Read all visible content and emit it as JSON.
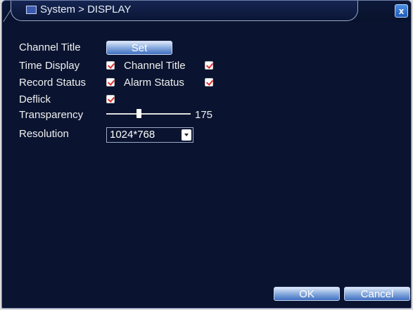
{
  "window": {
    "title": "System > DISPLAY",
    "close_symbol": "x"
  },
  "settings": {
    "channel_title_label": "Channel Title",
    "set_button_label": "Set",
    "time_display_label": "Time Display",
    "time_display_checked": true,
    "channel_title_check_label": "Channel Title",
    "channel_title_checked": true,
    "record_status_label": "Record Status",
    "record_status_checked": true,
    "alarm_status_label": "Alarm Status",
    "alarm_status_checked": true,
    "deflick_label": "Deflick",
    "deflick_checked": true,
    "transparency_label": "Transparency",
    "transparency_value": "175",
    "resolution_label": "Resolution",
    "resolution_value": "1024*768"
  },
  "footer": {
    "ok_label": "OK",
    "cancel_label": "Cancel"
  },
  "colors": {
    "background": "#0a1430",
    "check_mark": "#e03030",
    "button": "#3f6fc0"
  }
}
